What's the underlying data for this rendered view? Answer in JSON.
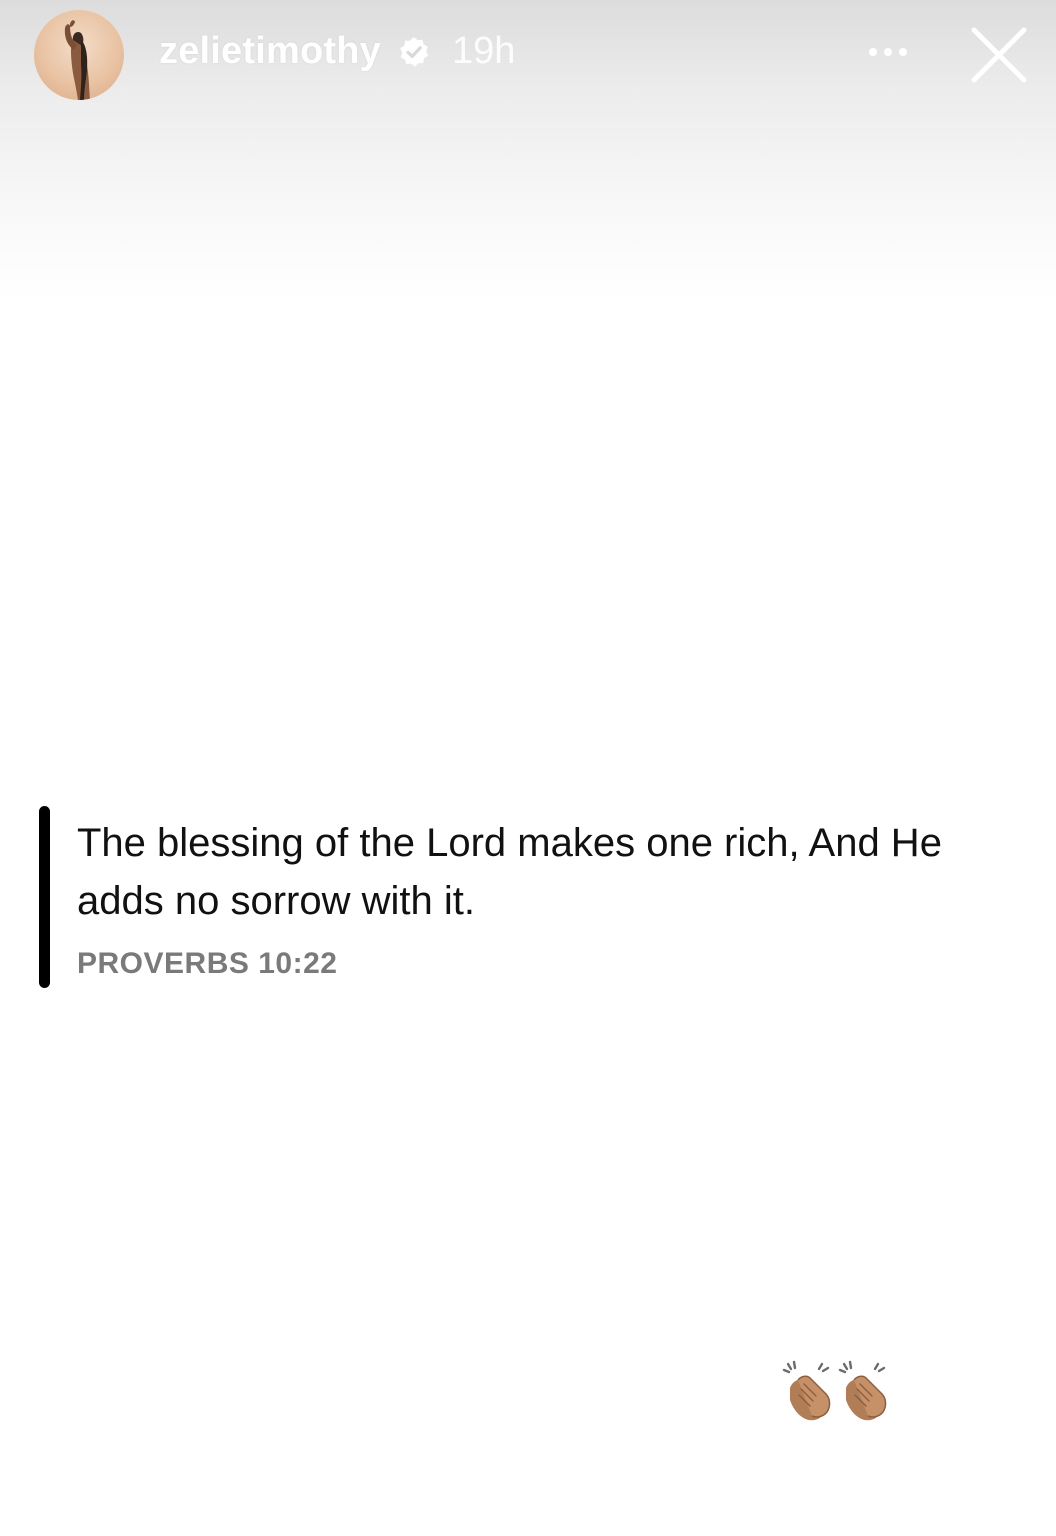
{
  "header": {
    "username": "zelietimothy",
    "timestamp": "19h",
    "verified": true
  },
  "story": {
    "quote": "The blessing of the Lord makes one rich, And He adds no sorrow with it.",
    "reference": "PROVERBS 10:22",
    "sticker_icons": [
      "clapping-hands-icon",
      "clapping-hands-icon"
    ]
  },
  "icons": {
    "more": "more-horizontal-icon",
    "close": "close-icon",
    "verified": "verified-badge-icon"
  },
  "colors": {
    "quote_bar": "#000000",
    "reference_text": "#7a7a7a",
    "header_text": "#ffffff"
  }
}
